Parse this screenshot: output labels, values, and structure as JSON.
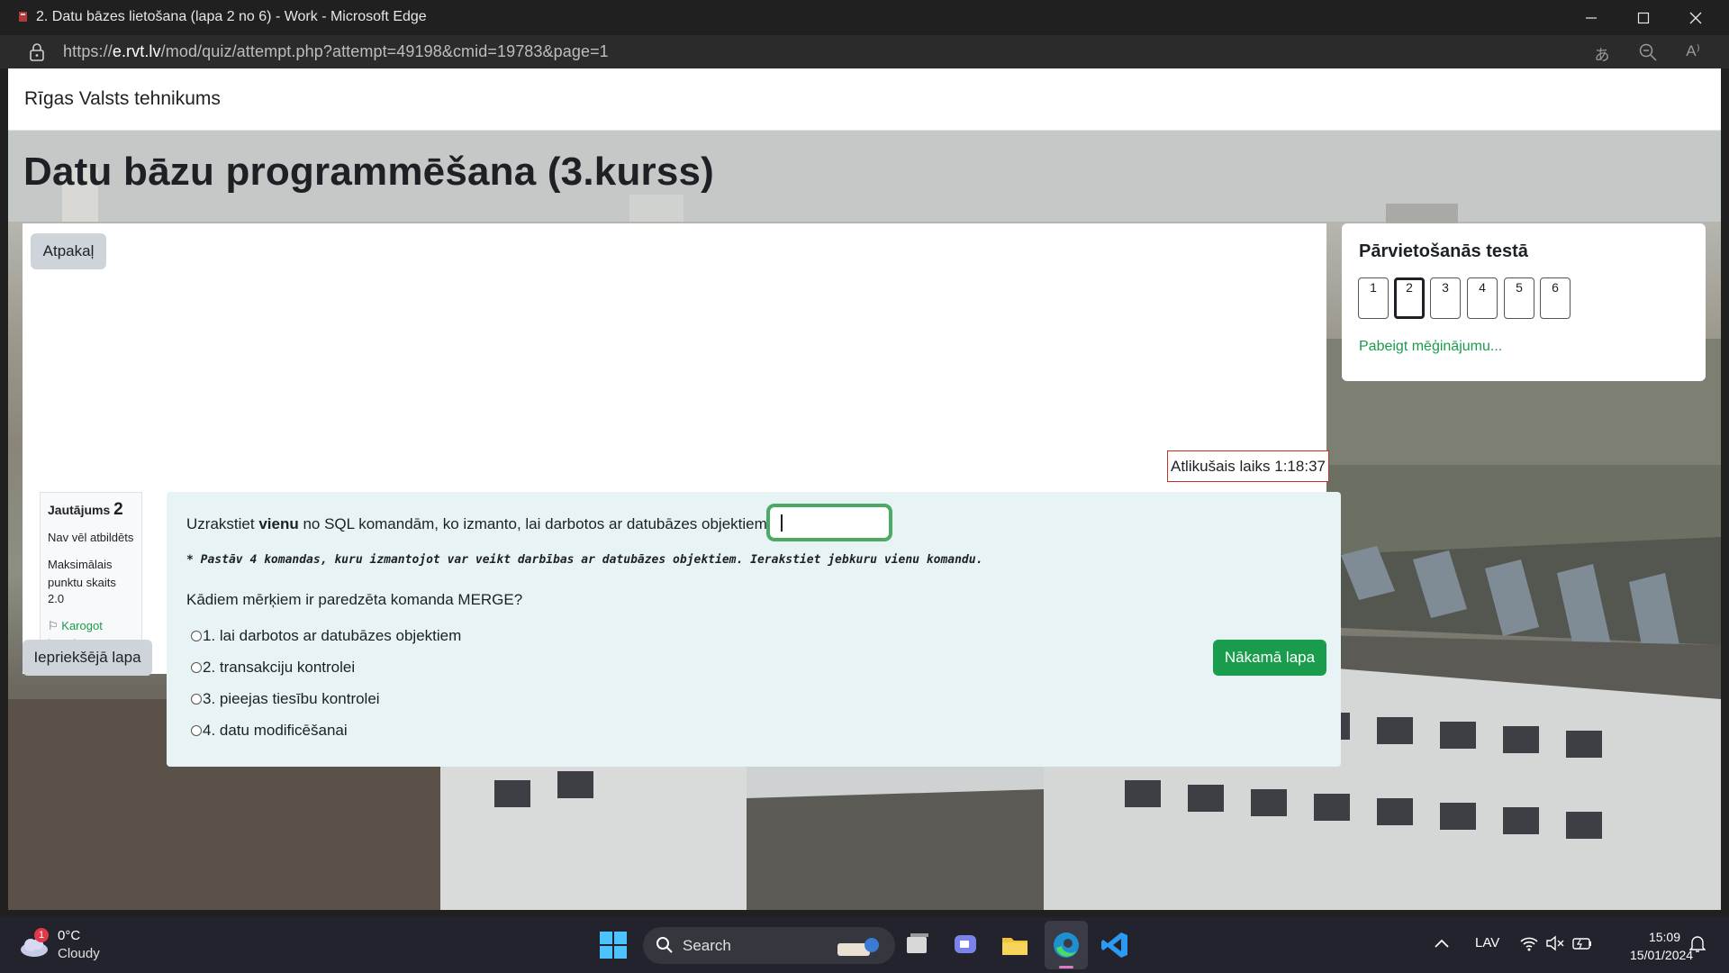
{
  "window": {
    "title": "2. Datu bāzes lietošana (lapa 2 no 6) - Work - Microsoft Edge"
  },
  "addressbar": {
    "url_prefix": "https://",
    "url_domain": "e.rvt.lv",
    "url_path": "/mod/quiz/attempt.php?attempt=49198&cmid=19783&page=1"
  },
  "site": {
    "name": "Rīgas Valsts tehnikums",
    "course_title": "Datu bāzu programmēšana (3.kurss)"
  },
  "quiz": {
    "back_label": "Atpakaļ",
    "timer_label": "Atlikušais laiks 1:18:37",
    "question_info": {
      "label": "Jautājums",
      "number": "2",
      "status": "Nav vēl atbildēts",
      "max_points_label": "Maksimālais punktu skaits",
      "max_points": "2.0",
      "flag_label": "Karogot jautājumu"
    },
    "question": {
      "text_before": "Uzrakstiet",
      "text_bold": "vienu",
      "text_after": "no SQL komandām, ko izmanto, lai darbotos ar datubāzes objektiem",
      "answer_value": "",
      "hint": "* Pastāv 4 komandas, kuru izmantojot var veikt darbības ar datubāzes objektiem. Ierakstiet jebkuru vienu komandu.",
      "second_prompt": "Kādiem mērķiem ir paredzēta komanda MERGE?",
      "options": [
        "1. lai darbotos ar datubāzes objektiem",
        "2. transakciju kontrolei",
        "3. pieejas tiesību kontrolei",
        "4. datu modificēšanai"
      ]
    },
    "prev_label": "Iepriekšējā lapa",
    "next_label": "Nākamā lapa"
  },
  "navigation": {
    "title": "Pārvietošanās testā",
    "pages": [
      "1",
      "2",
      "3",
      "4",
      "5",
      "6"
    ],
    "current_page": "2",
    "finish_label": "Pabeigt mēģinājumu..."
  },
  "taskbar": {
    "weather_temp": "0°C",
    "weather_condition": "Cloudy",
    "weather_badge": "1",
    "search_label": "Search",
    "language": "LAV",
    "time": "15:09",
    "date": "15/01/2024"
  },
  "colors": {
    "accent_green": "#1a9c4d",
    "timer_border": "#ca3120",
    "question_bg": "#e7f3f5"
  }
}
